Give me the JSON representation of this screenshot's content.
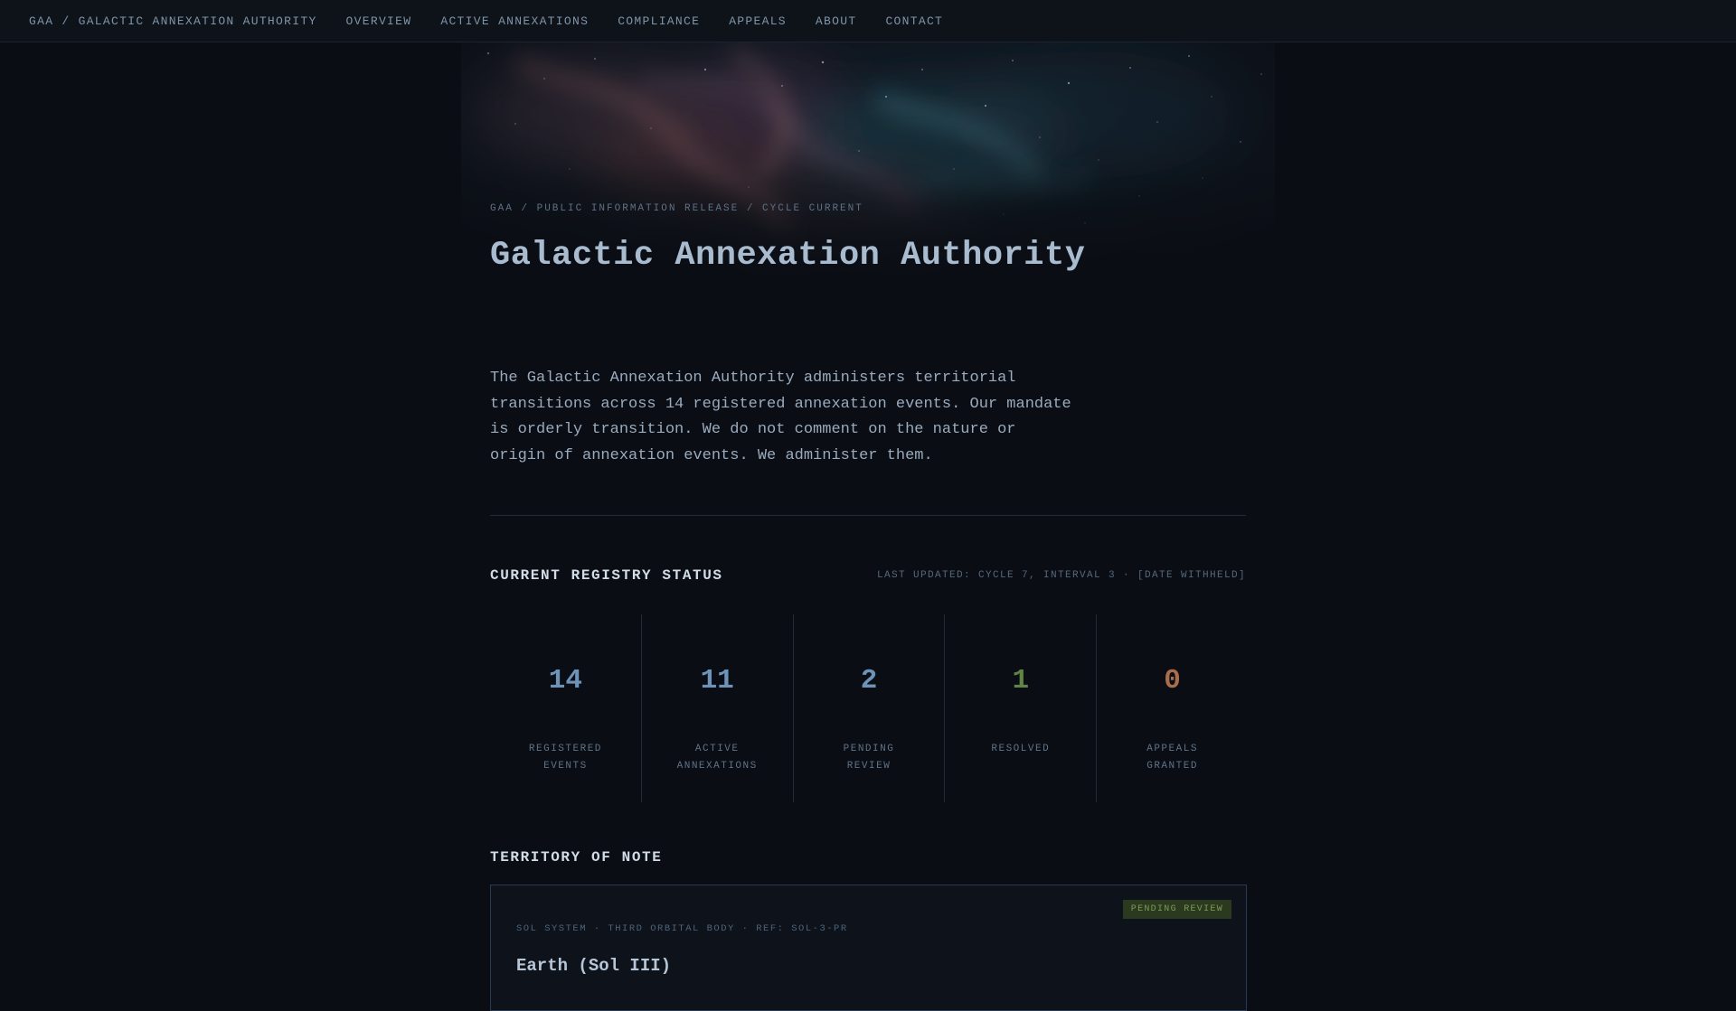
{
  "nav": {
    "brand": "GAA / GALACTIC ANNEXATION AUTHORITY",
    "items": [
      "OVERVIEW",
      "ACTIVE ANNEXATIONS",
      "COMPLIANCE",
      "APPEALS",
      "ABOUT",
      "CONTACT"
    ]
  },
  "hero": {
    "breadcrumb": "GAA / PUBLIC INFORMATION RELEASE / CYCLE CURRENT",
    "title": "Galactic Annexation Authority"
  },
  "intro": {
    "text": "The Galactic Annexation Authority administers territorial transitions across 14 registered annexation events. Our mandate is orderly transition. We do not comment on the nature or origin of annexation events. We administer them."
  },
  "registry": {
    "title": "CURRENT REGISTRY STATUS",
    "last_updated": "LAST UPDATED: CYCLE 7, INTERVAL 3 · [DATE WITHHELD]",
    "stats": [
      {
        "value": "14",
        "label": "REGISTERED EVENTS",
        "color": "#6d93b8"
      },
      {
        "value": "11",
        "label": "ACTIVE ANNEXATIONS",
        "color": "#6d93b8"
      },
      {
        "value": "2",
        "label": "PENDING REVIEW",
        "color": "#6d93b8"
      },
      {
        "value": "1",
        "label": "RESOLVED",
        "color": "#5f8446"
      },
      {
        "value": "0",
        "label": "APPEALS GRANTED",
        "color": "#a86e4c"
      }
    ]
  },
  "territory": {
    "title": "TERRITORY OF NOTE",
    "badge": "PENDING REVIEW",
    "ref": "SOL SYSTEM · THIRD ORBITAL BODY · REF: SOL-3-PR",
    "name": "Earth (Sol III)"
  },
  "colors": {
    "background": "#0a0d13",
    "accent_blue": "#6d93b8",
    "accent_green": "#5f8446",
    "accent_orange": "#a86e4c"
  }
}
